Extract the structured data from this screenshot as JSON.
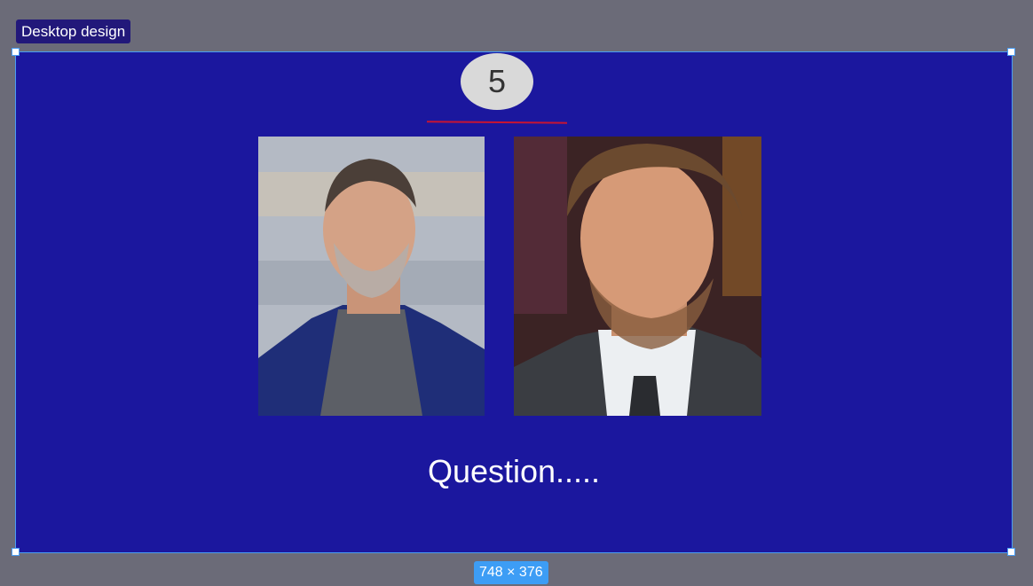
{
  "frame": {
    "label": "Desktop design",
    "size_label": "748 × 376",
    "background": "#1b179e",
    "selection_color": "#4a9df4"
  },
  "slide": {
    "counter": "5",
    "question": "Question.....",
    "underline_color": "#c81432"
  },
  "images": [
    {
      "name": "portrait-left",
      "icon": "portrait-image"
    },
    {
      "name": "portrait-right",
      "icon": "portrait-image"
    }
  ]
}
